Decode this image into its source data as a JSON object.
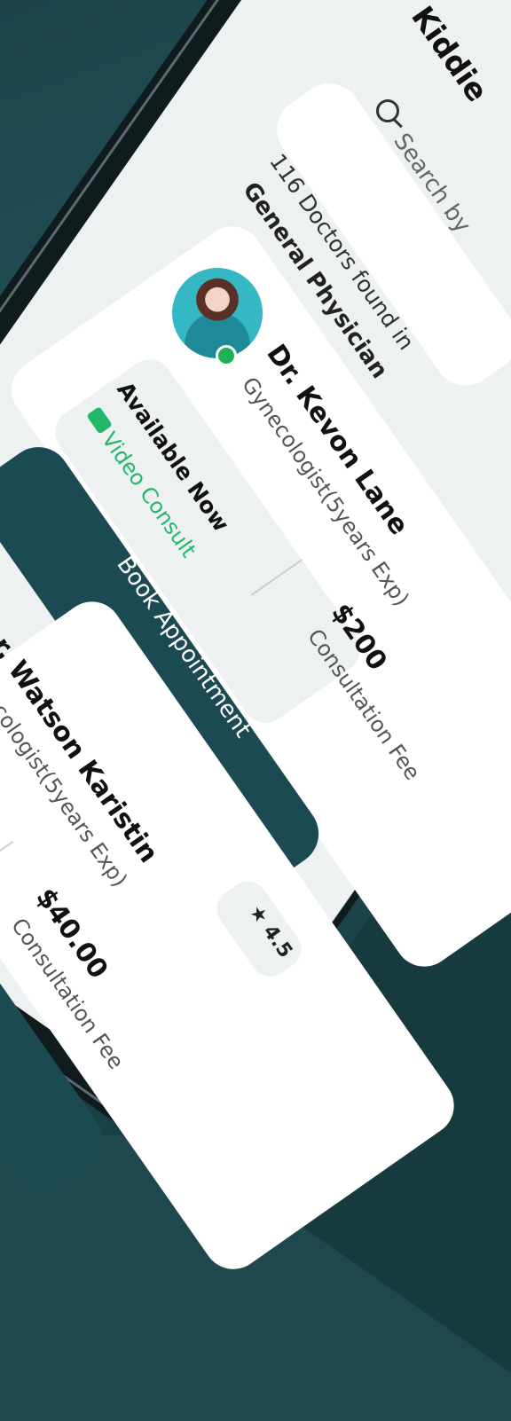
{
  "app": {
    "title": "Kiddie"
  },
  "search": {
    "placeholder": "Search by"
  },
  "results": {
    "count_text": "116 Doctors found in",
    "category": "General Physician"
  },
  "doctors": [
    {
      "name": "Dr. Kevon Lane",
      "specialty": "Gynecologist(5years Exp)",
      "availability": "Available Now",
      "consult_type": "Video Consult",
      "fee": "$200",
      "fee_label": "Consultation Fee",
      "button_label": "Book Appointment"
    },
    {
      "name": "r. Watson Karistin",
      "specialty": "ecologist(5years Exp)",
      "fee": "$40.00",
      "fee_label": "Consultation Fee",
      "rating": "4.5"
    }
  ],
  "colors": {
    "primary": "#1c4a52",
    "success": "#23b76a",
    "background": "#1f474e"
  },
  "icons": {
    "search": "search-icon",
    "video": "video-icon",
    "star": "star-icon",
    "chevron": "chevron-right-icon"
  }
}
